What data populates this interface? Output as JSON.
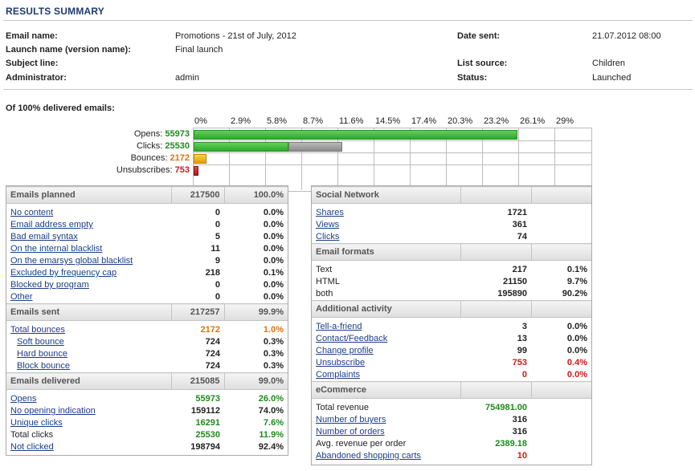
{
  "title": "RESULTS SUMMARY",
  "info": {
    "left": [
      {
        "label": "Email name:",
        "value": "Promotions - 21st of July, 2012"
      },
      {
        "label": "Launch name (version name):",
        "value": "Final launch"
      },
      {
        "label": "Subject line:",
        "value": ""
      },
      {
        "label": "Administrator:",
        "value": "admin"
      }
    ],
    "right": [
      {
        "label": "Date sent:",
        "value": "21.07.2012 08:00"
      },
      {
        "label": "",
        "value": ""
      },
      {
        "label": "List source:",
        "value": "Children"
      },
      {
        "label": "Status:",
        "value": "Launched"
      }
    ]
  },
  "delivered_label": "Of 100% delivered emails:",
  "chart_data": {
    "type": "bar",
    "orientation": "horizontal",
    "ticks": [
      "0%",
      "2.9%",
      "5.8%",
      "8.7%",
      "11.6%",
      "14.5%",
      "17.4%",
      "20.3%",
      "23.2%",
      "26.1%",
      "29%"
    ],
    "xlim": [
      0,
      29
    ],
    "rows": [
      {
        "name": "Opens",
        "value_label": "55973",
        "pct": 26.0,
        "secondary_pct": 0,
        "color": "#3cbf38"
      },
      {
        "name": "Clicks",
        "value_label": "25530",
        "pct": 7.6,
        "secondary_pct": 4.3,
        "color": "#3cbf38"
      },
      {
        "name": "Bounces",
        "value_label": "2172",
        "pct": 1.0,
        "secondary_pct": 0,
        "color": "#f0a800"
      },
      {
        "name": "Unsubscribes",
        "value_label": "753",
        "pct": 0.4,
        "secondary_pct": 0,
        "color": "#c81e1e"
      }
    ]
  },
  "left_table": {
    "sections": [
      {
        "header": {
          "label": "Emails planned",
          "count": "217500",
          "pct": "100.0%"
        },
        "rows": [
          {
            "label": "No content",
            "count": "0",
            "pct": "0.0%",
            "link": true
          },
          {
            "label": "Email address empty",
            "count": "0",
            "pct": "0.0%",
            "link": true
          },
          {
            "label": "Bad email syntax",
            "count": "5",
            "pct": "0.0%",
            "link": true
          },
          {
            "label": "On the internal blacklist",
            "count": "11",
            "pct": "0.0%",
            "link": true
          },
          {
            "label": "On the emarsys global blacklist",
            "count": "9",
            "pct": "0.0%",
            "link": true
          },
          {
            "label": "Excluded by frequency cap",
            "count": "218",
            "pct": "0.1%",
            "link": true
          },
          {
            "label": "Blocked by program",
            "count": "0",
            "pct": "0.0%",
            "link": true
          },
          {
            "label": "Other",
            "count": "0",
            "pct": "0.0%",
            "link": true
          }
        ]
      },
      {
        "header": {
          "label": "Emails sent",
          "count": "217257",
          "pct": "99.9%"
        },
        "rows": [
          {
            "label": "Total bounces",
            "count": "2172",
            "pct": "1.0%",
            "link": true,
            "color": "orange"
          },
          {
            "label": "Soft bounce",
            "count": "724",
            "pct": "0.3%",
            "link": true,
            "indent": true
          },
          {
            "label": "Hard bounce",
            "count": "724",
            "pct": "0.3%",
            "link": true,
            "indent": true
          },
          {
            "label": "Block bounce",
            "count": "724",
            "pct": "0.3%",
            "link": true,
            "indent": true
          }
        ]
      },
      {
        "header": {
          "label": "Emails delivered",
          "count": "215085",
          "pct": "99.0%"
        },
        "rows": [
          {
            "label": "Opens",
            "count": "55973",
            "pct": "26.0%",
            "link": true,
            "color": "green"
          },
          {
            "label": "No opening indication",
            "count": "159112",
            "pct": "74.0%",
            "link": true
          },
          {
            "label": "Unique clicks",
            "count": "16291",
            "pct": "7.6%",
            "link": true,
            "color": "green"
          },
          {
            "label": "Total clicks",
            "count": "25530",
            "pct": "11.9%",
            "link": false,
            "color": "green"
          },
          {
            "label": "Not clicked",
            "count": "198794",
            "pct": "92.4%",
            "link": true
          }
        ]
      }
    ]
  },
  "right_table": {
    "sections": [
      {
        "header": {
          "label": "Social Network",
          "count": "",
          "pct": ""
        },
        "rows": [
          {
            "label": "Shares",
            "count": "1721",
            "pct": "",
            "link": true
          },
          {
            "label": "Views",
            "count": "361",
            "pct": "",
            "link": true
          },
          {
            "label": "Clicks",
            "count": "74",
            "pct": "",
            "link": true
          }
        ]
      },
      {
        "header": {
          "label": "Email formats",
          "count": "",
          "pct": ""
        },
        "rows": [
          {
            "label": "Text",
            "count": "217",
            "pct": "0.1%",
            "link": false
          },
          {
            "label": "HTML",
            "count": "21150",
            "pct": "9.7%",
            "link": false
          },
          {
            "label": "both",
            "count": "195890",
            "pct": "90.2%",
            "link": false
          }
        ]
      },
      {
        "header": {
          "label": "Additional activity",
          "count": "",
          "pct": ""
        },
        "rows": [
          {
            "label": "Tell-a-friend",
            "count": "3",
            "pct": "0.0%",
            "link": true
          },
          {
            "label": "Contact/Feedback",
            "count": "13",
            "pct": "0.0%",
            "link": true
          },
          {
            "label": "Change profile",
            "count": "99",
            "pct": "0.0%",
            "link": true
          },
          {
            "label": "Unsubscribe",
            "count": "753",
            "pct": "0.4%",
            "link": true,
            "color": "red"
          },
          {
            "label": "Complaints",
            "count": "0",
            "pct": "0.0%",
            "link": true,
            "color": "red"
          }
        ]
      },
      {
        "header": {
          "label": "eCommerce",
          "count": "",
          "pct": ""
        },
        "rows": [
          {
            "label": "Total revenue",
            "count": "754981.00",
            "pct": "",
            "link": false,
            "color": "green"
          },
          {
            "label": "Number of buyers",
            "count": "316",
            "pct": "",
            "link": true
          },
          {
            "label": "Number of orders",
            "count": "316",
            "pct": "",
            "link": true
          },
          {
            "label": "Avg. revenue per order",
            "count": "2389.18",
            "pct": "",
            "link": false,
            "color": "green"
          },
          {
            "label": "Abandoned shopping carts",
            "count": "10",
            "pct": "",
            "link": true,
            "color": "red"
          }
        ]
      }
    ]
  }
}
